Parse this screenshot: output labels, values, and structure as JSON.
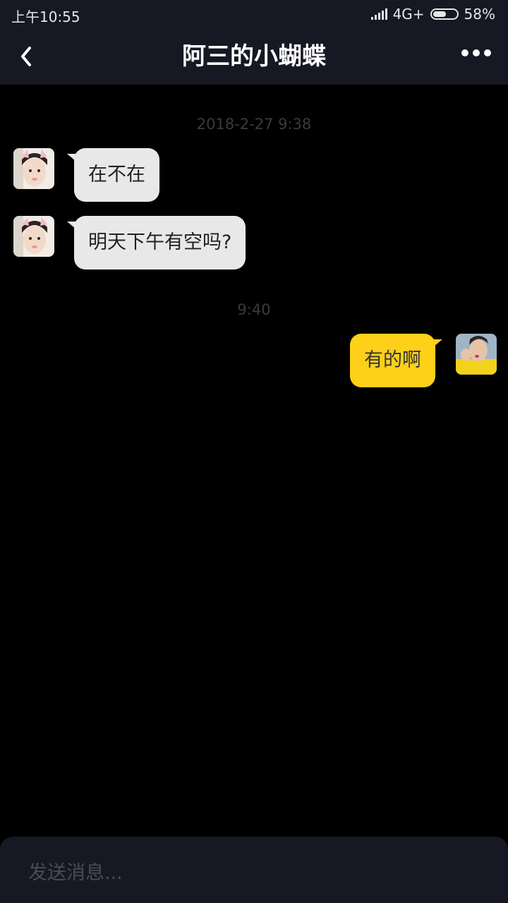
{
  "status_bar": {
    "time": "上午10:55",
    "network": "4G+",
    "battery": "58%",
    "battery_level": 0.58
  },
  "header": {
    "title": "阿三的小蝴蝶"
  },
  "chat": {
    "timestamps": [
      "2018-2-27 9:38",
      "9:40"
    ],
    "messages": [
      {
        "sender": "other",
        "text": "在不在"
      },
      {
        "sender": "other",
        "text": "明天下午有空吗?"
      },
      {
        "sender": "me",
        "text": "有的啊"
      }
    ]
  },
  "input": {
    "placeholder": "发送消息..."
  },
  "colors": {
    "bar_background": "#161823",
    "page_background": "#000000",
    "incoming_bubble": "#e8e8e8",
    "outgoing_bubble": "#fdd019"
  }
}
